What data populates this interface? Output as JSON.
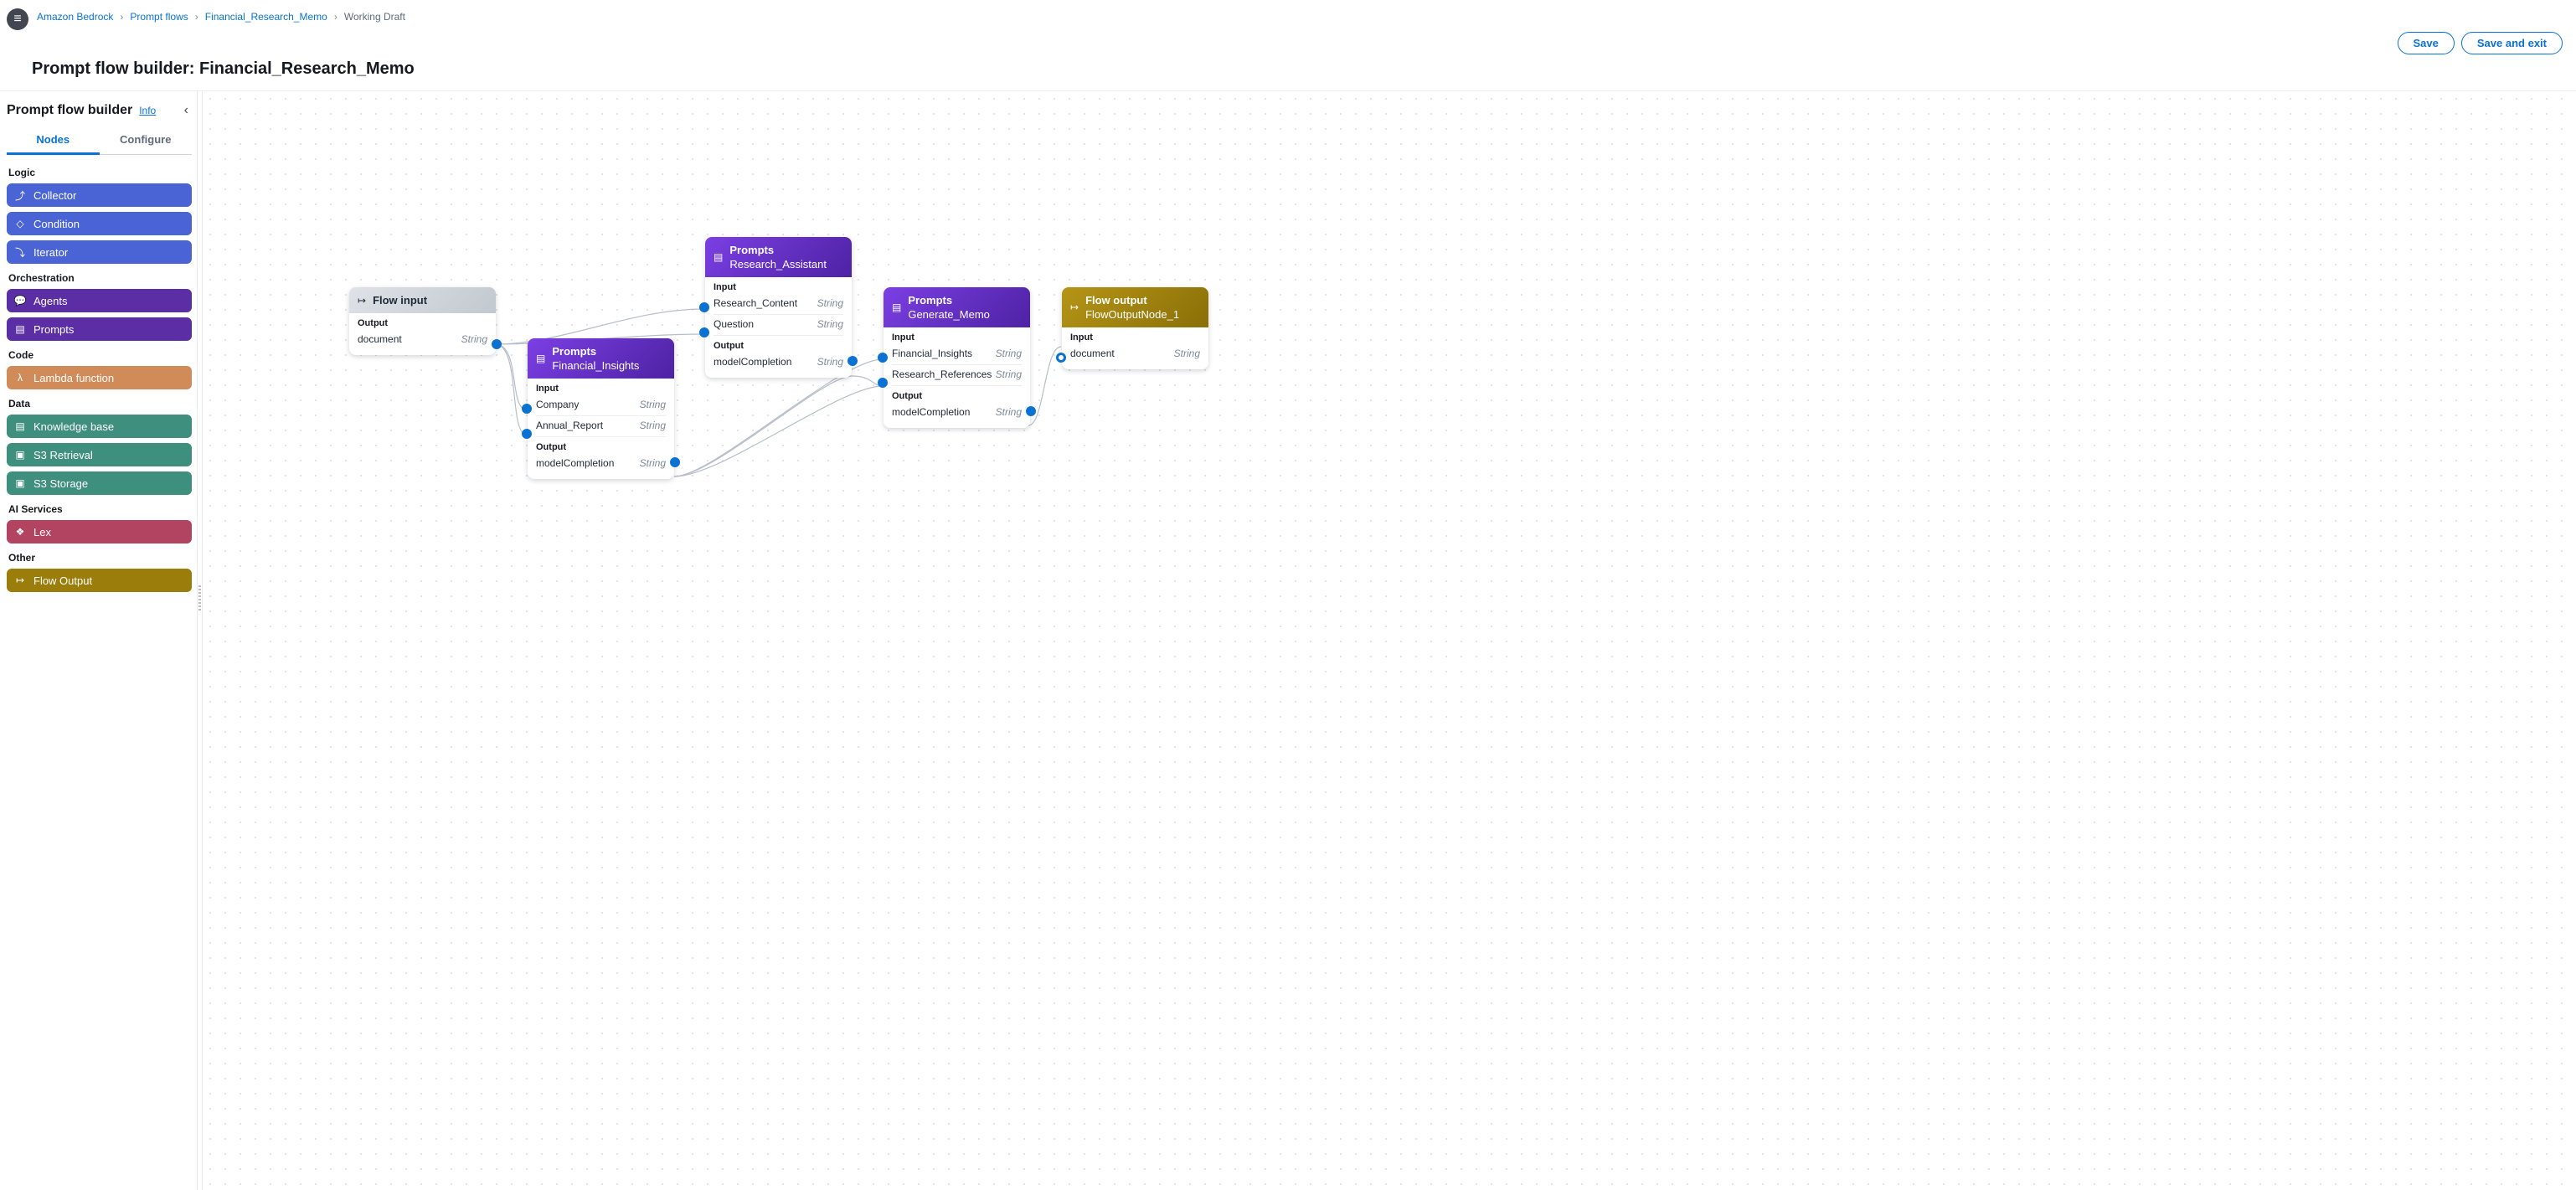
{
  "breadcrumbs": {
    "items": [
      {
        "label": "Amazon Bedrock",
        "link": true
      },
      {
        "label": "Prompt flows",
        "link": true
      },
      {
        "label": "Financial_Research_Memo",
        "link": true
      },
      {
        "label": "Working Draft",
        "link": false
      }
    ]
  },
  "page_title": "Prompt flow builder: Financial_Research_Memo",
  "buttons": {
    "save": "Save",
    "save_exit": "Save and exit"
  },
  "sidebar": {
    "title": "Prompt flow builder",
    "info": "Info",
    "tabs": {
      "nodes": "Nodes",
      "configure": "Configure"
    },
    "groups": [
      {
        "title": "Logic",
        "items": [
          {
            "label": "Collector",
            "palette": "pal-blue",
            "icon": "⤴"
          },
          {
            "label": "Condition",
            "palette": "pal-blue",
            "icon": "◇"
          },
          {
            "label": "Iterator",
            "palette": "pal-blue",
            "icon": "⤵"
          }
        ]
      },
      {
        "title": "Orchestration",
        "items": [
          {
            "label": "Agents",
            "palette": "pal-purple",
            "icon": "💬"
          },
          {
            "label": "Prompts",
            "palette": "pal-purple",
            "icon": "▤"
          }
        ]
      },
      {
        "title": "Code",
        "items": [
          {
            "label": "Lambda function",
            "palette": "pal-orange",
            "icon": "λ"
          }
        ]
      },
      {
        "title": "Data",
        "items": [
          {
            "label": "Knowledge base",
            "palette": "pal-teal",
            "icon": "▤"
          },
          {
            "label": "S3 Retrieval",
            "palette": "pal-teal",
            "icon": "▣"
          },
          {
            "label": "S3 Storage",
            "palette": "pal-teal",
            "icon": "▣"
          }
        ]
      },
      {
        "title": "AI Services",
        "items": [
          {
            "label": "Lex",
            "palette": "pal-pink",
            "icon": "❖"
          }
        ]
      },
      {
        "title": "Other",
        "items": [
          {
            "label": "Flow Output",
            "palette": "pal-olive",
            "icon": "↦"
          }
        ]
      }
    ]
  },
  "canvas": {
    "labels": {
      "input": "Input",
      "output": "Output",
      "string": "String"
    },
    "flow_input": {
      "title": "Flow input",
      "out_name": "document"
    },
    "financial_insights": {
      "type": "Prompts",
      "name": "Financial_Insights",
      "inputs": [
        {
          "name": "Company"
        },
        {
          "name": "Annual_Report"
        }
      ],
      "outputs": [
        {
          "name": "modelCompletion"
        }
      ]
    },
    "research_assistant": {
      "type": "Prompts",
      "name": "Research_Assistant",
      "inputs": [
        {
          "name": "Research_Content"
        },
        {
          "name": "Question"
        }
      ],
      "outputs": [
        {
          "name": "modelCompletion"
        }
      ]
    },
    "generate_memo": {
      "type": "Prompts",
      "name": "Generate_Memo",
      "inputs": [
        {
          "name": "Financial_Insights"
        },
        {
          "name": "Research_References"
        }
      ],
      "outputs": [
        {
          "name": "modelCompletion"
        }
      ]
    },
    "flow_output": {
      "title": "Flow output",
      "name": "FlowOutputNode_1",
      "in_name": "document"
    }
  }
}
